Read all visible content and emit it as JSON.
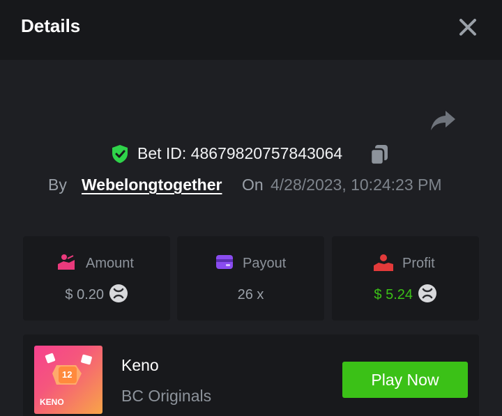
{
  "header": {
    "title": "Details"
  },
  "bet": {
    "id_label": "Bet ID: 48679820757843064",
    "by_label": "By",
    "username": "Webelongtogether",
    "on_label": "On",
    "datetime": "4/28/2023, 10:24:23 PM"
  },
  "stats": [
    {
      "label": "Amount",
      "value": "$ 0.20",
      "icon": "hand-coin-icon",
      "color": "#ea3a7c"
    },
    {
      "label": "Payout",
      "value": "26 x",
      "icon": "wallet-icon",
      "color": "#8a4cf0"
    },
    {
      "label": "Profit",
      "value": "$ 5.24",
      "icon": "profit-hand-icon",
      "color": "#e23a3a",
      "value_color": "#3bc117"
    }
  ],
  "game": {
    "name": "Keno",
    "provider": "BC Originals",
    "thumb_label": "KENO",
    "thumb_number": "12",
    "play_label": "Play Now"
  },
  "colors": {
    "accent_green": "#3bc117",
    "shield_green": "#2fd34a",
    "bg": "#1e1f23",
    "header_bg": "#17181b"
  }
}
